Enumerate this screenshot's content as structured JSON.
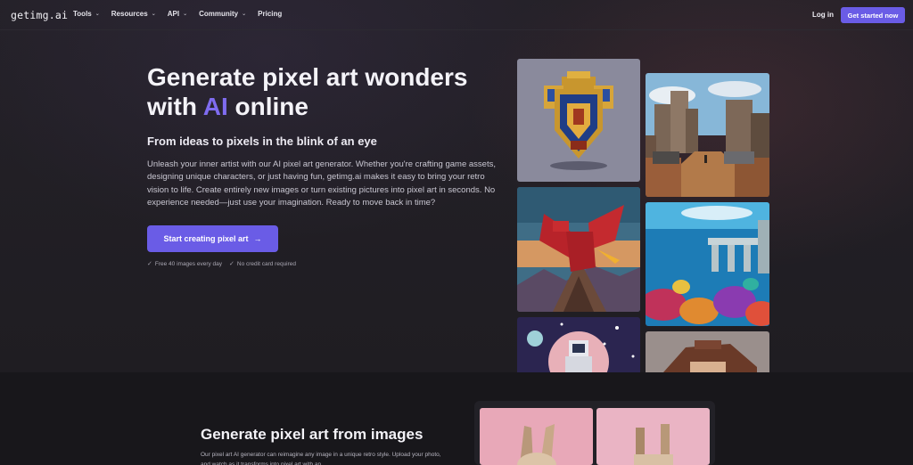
{
  "nav": {
    "logo": "getimg.ai",
    "links": [
      {
        "label": "Tools",
        "has_dropdown": true
      },
      {
        "label": "Resources",
        "has_dropdown": true
      },
      {
        "label": "API",
        "has_dropdown": true
      },
      {
        "label": "Community",
        "has_dropdown": true
      },
      {
        "label": "Pricing",
        "has_dropdown": false
      }
    ],
    "login": "Log in",
    "get_started": "Get started now"
  },
  "hero": {
    "title_part1": "Generate pixel art wonders with ",
    "title_accent": "AI",
    "title_part2": " online",
    "subtitle": "From ideas to pixels in the blink of an eye",
    "description": "Unleash your inner artist with our AI pixel art generator. Whether you're crafting game assets, designing unique characters, or just having fun, getimg.ai makes it easy to bring your retro vision to life. Create entirely new images or turn existing pictures into pixel art in seconds. No experience needed—just use your imagination. Ready to move back in time?",
    "cta": "Start creating pixel art",
    "cta_icon": "arrow-right-icon",
    "checks": [
      "Free 40 images every day",
      "No credit card required"
    ]
  },
  "gallery": [
    {
      "name": "pixel-shield-image"
    },
    {
      "name": "pixel-ruined-city-image"
    },
    {
      "name": "pixel-dragon-image"
    },
    {
      "name": "pixel-underwater-ruins-image"
    },
    {
      "name": "pixel-astronaut-image"
    },
    {
      "name": "pixel-pirate-image"
    }
  ],
  "section2": {
    "title": "Generate pixel art from images",
    "text": "Our pixel art AI generator can reimagine any image in a unique retro style. Upload your photo, and watch as it transforms into pixel art with an"
  },
  "colors": {
    "accent": "#6a5ce6",
    "accent_text": "#7f6cf0",
    "background": "#1b1a1e"
  }
}
